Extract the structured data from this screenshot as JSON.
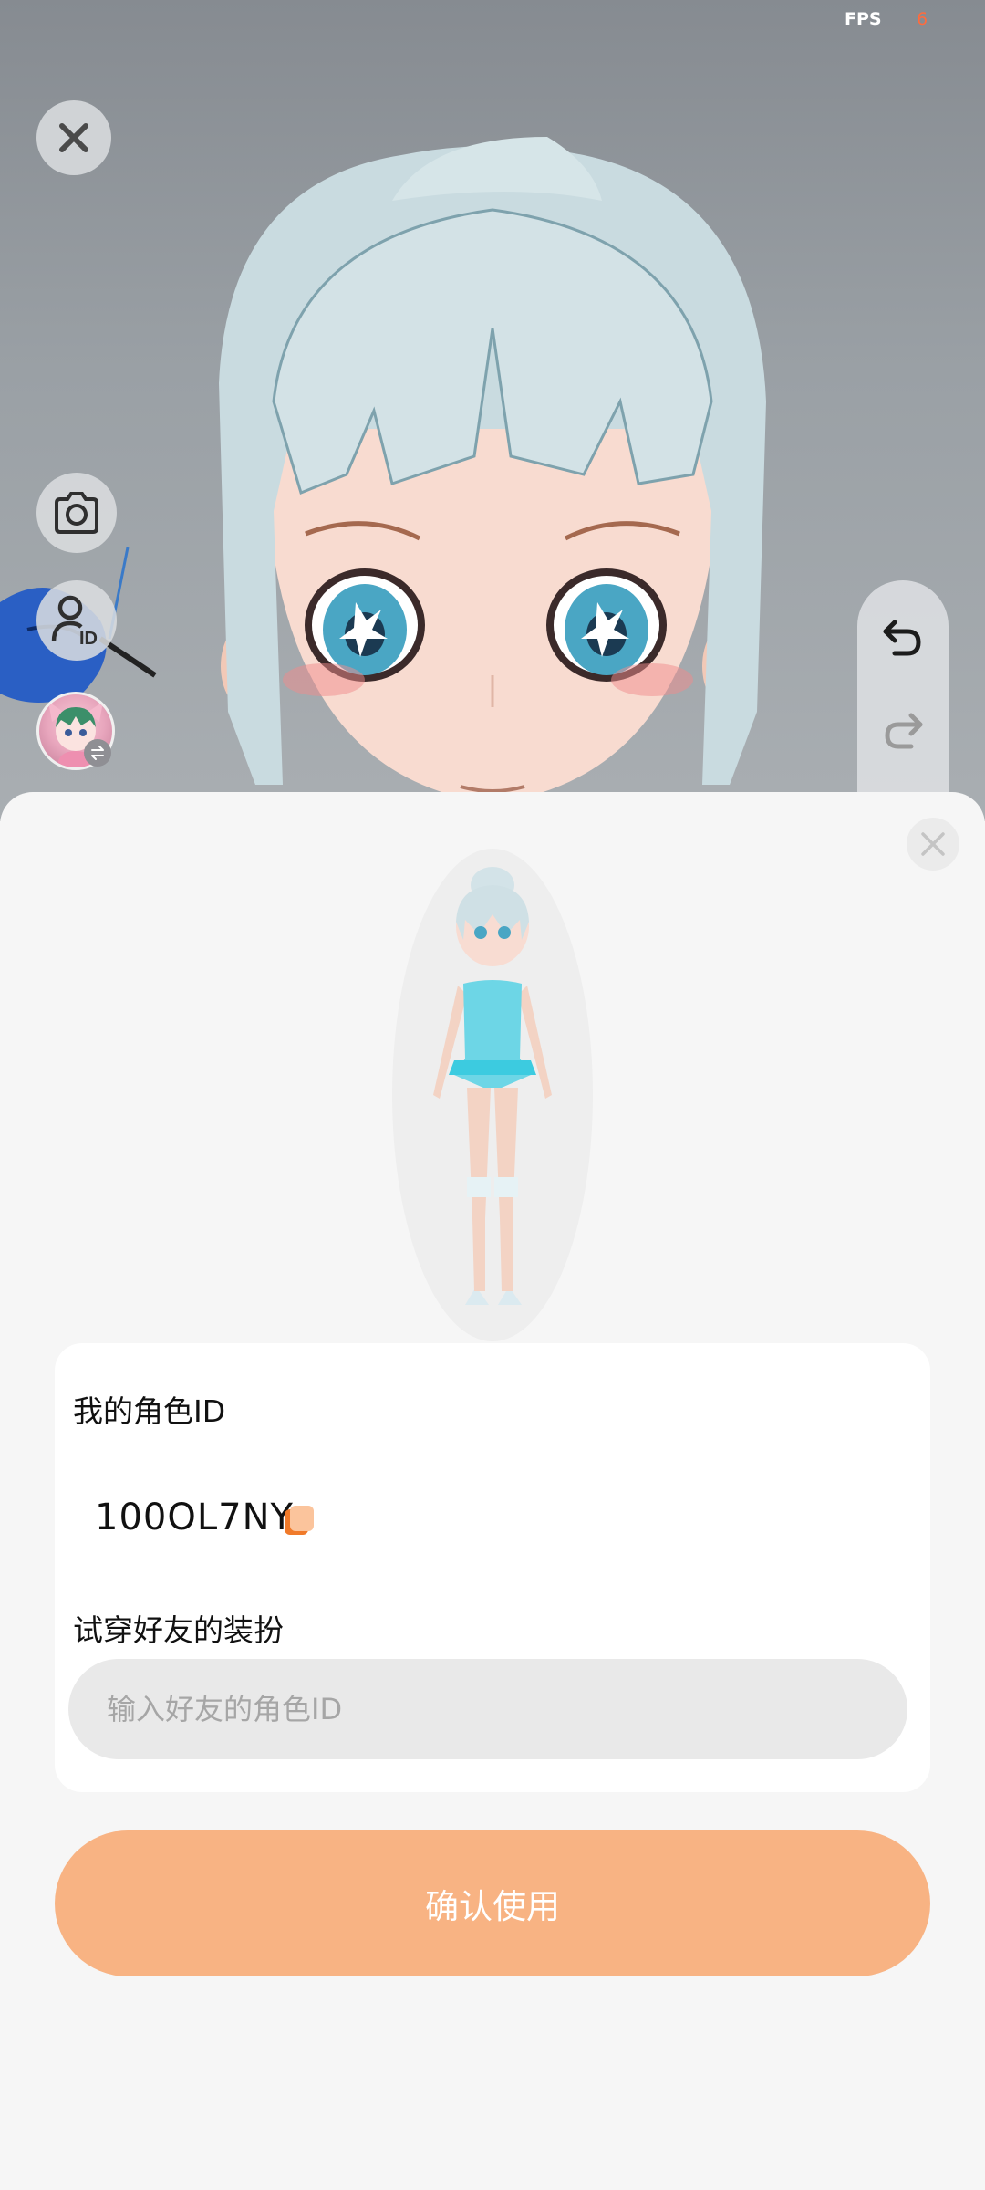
{
  "status": {
    "fps_label": "FPS",
    "fps_value": "6"
  },
  "viewport": {
    "buttons": {
      "close": "close-icon",
      "camera": "camera-icon",
      "role_id": "user-id-icon",
      "avatar": "avatar-swap-icon"
    },
    "history": {
      "undo": "undo-icon",
      "redo": "redo-icon"
    }
  },
  "sheet": {
    "close_icon": "close-icon",
    "my_role_id_label": "我的角色ID",
    "my_role_id_value": "100OL7NY",
    "try_friend_label": "试穿好友的装扮",
    "friend_input_placeholder": "输入好友的角色ID",
    "friend_input_value": "",
    "confirm_label": "确认使用"
  },
  "colors": {
    "accent": "#f8b383",
    "fps_value": "#ff6b3d",
    "sheet_bg": "#f6f6f6"
  }
}
